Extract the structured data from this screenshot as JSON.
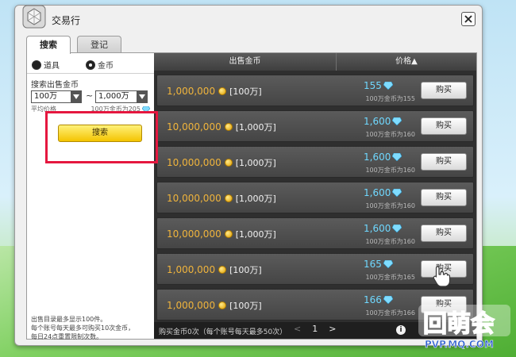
{
  "window": {
    "title": "交易行",
    "tabs": [
      {
        "label": "搜索",
        "active": true
      },
      {
        "label": "登记",
        "active": false
      }
    ]
  },
  "search_panel": {
    "radio_item": "道具",
    "radio_coin": "金币",
    "selected": "金币",
    "search_label": "搜索出售金币",
    "min_value": "100万",
    "tilde": "~",
    "max_value": "1,000万",
    "avg_label": "平均价格",
    "avg_value": "100万金币为205",
    "search_button": "搜索",
    "footer_lines": [
      "出售目录最多显示100件。",
      "每个账号每天最多可购买10次金币，",
      "每日24点重置限制次数。"
    ]
  },
  "list": {
    "header_sell": "出售金币",
    "header_price": "价格▲",
    "buy_label": "购买",
    "rows": [
      {
        "amount": "1,000,000",
        "unit": "[100万]",
        "price": "155",
        "rate": "100万金币为155"
      },
      {
        "amount": "10,000,000",
        "unit": "[1,000万]",
        "price": "1,600",
        "rate": "100万金币为160"
      },
      {
        "amount": "10,000,000",
        "unit": "[1,000万]",
        "price": "1,600",
        "rate": "100万金币为160"
      },
      {
        "amount": "10,000,000",
        "unit": "[1,000万]",
        "price": "1,600",
        "rate": "100万金币为160"
      },
      {
        "amount": "10,000,000",
        "unit": "[1,000万]",
        "price": "1,600",
        "rate": "100万金币为160"
      },
      {
        "amount": "1,000,000",
        "unit": "[100万]",
        "price": "165",
        "rate": "100万金币为165"
      },
      {
        "amount": "1,000,000",
        "unit": "[100万]",
        "price": "166",
        "rate": "100万金币为166"
      }
    ],
    "footer_text": "购买金币0次（每个账号每天最多50次）",
    "page_prev": "<",
    "page_number": "1",
    "page_next": ">"
  },
  "colors": {
    "highlight": "#e5173f",
    "gold_text": "#f0b43c",
    "price_text": "#6fd8ff"
  },
  "icons": {
    "coin": "coin-icon",
    "gem": "gem-icon",
    "close": "close-icon",
    "info": "info-icon"
  }
}
